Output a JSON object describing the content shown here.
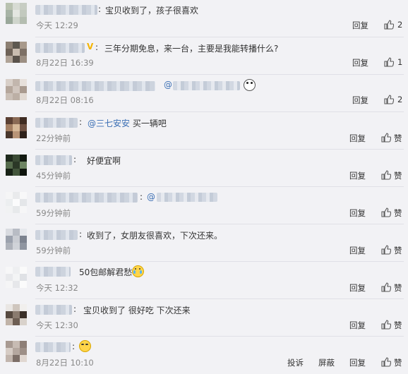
{
  "labels": {
    "reply": "回复",
    "praise": "赞",
    "report": "投诉",
    "block": "屏蔽"
  },
  "comments": [
    {
      "text": "宝贝收到了，孩子很喜欢",
      "time": "今天 12:29",
      "likes": "2"
    },
    {
      "text": "三年分期免息，来一台，主要是我能转播什么?",
      "time": "8月22日 16:39",
      "likes": "1"
    },
    {
      "text": "@",
      "time": "8月22日 08:16",
      "likes": "2"
    },
    {
      "mention": "@三七安安",
      "text": " 买一辆吧",
      "time": "22分钟前"
    },
    {
      "text": "好便宜啊",
      "time": "45分钟前"
    },
    {
      "text": "@",
      "time": "59分钟前"
    },
    {
      "text": "收到了，女朋友很喜欢，下次还来。",
      "time": "59分钟前"
    },
    {
      "text": "50包邮解君愁",
      "time": "今天 12:32"
    },
    {
      "text": "宝贝收到了 很好吃 下次还来",
      "time": "今天 12:30"
    },
    {
      "text": "",
      "time": "8月22日 10:10"
    }
  ]
}
